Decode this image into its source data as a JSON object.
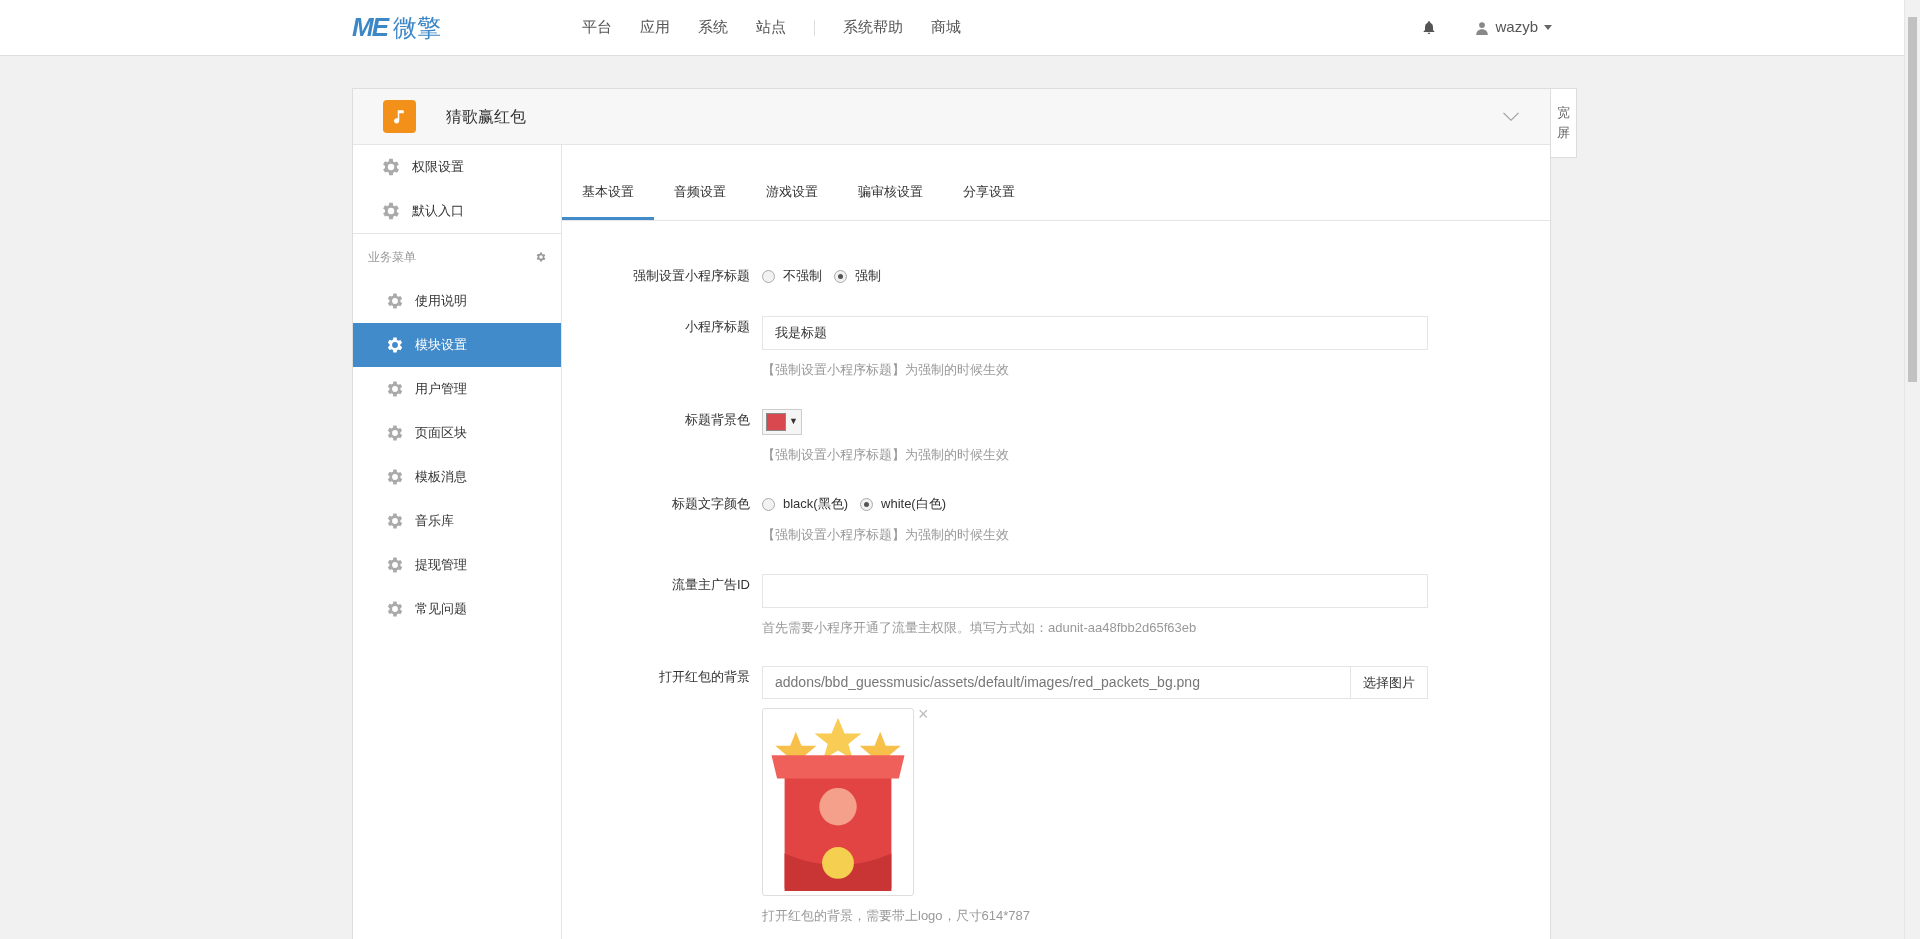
{
  "header": {
    "logo_mark": "ME",
    "logo_text": "微擎",
    "nav": [
      {
        "label": "平台",
        "kind": "link"
      },
      {
        "label": "应用",
        "kind": "link"
      },
      {
        "label": "系统",
        "kind": "link"
      },
      {
        "label": "站点",
        "kind": "link"
      },
      {
        "kind": "divider"
      },
      {
        "label": "系统帮助",
        "kind": "link"
      },
      {
        "label": "商城",
        "kind": "link"
      }
    ],
    "user": "wazyb"
  },
  "module": {
    "name": "猜歌赢红包",
    "widescreen_button": "宽屏"
  },
  "sidebar": {
    "top_items": [
      {
        "label": "权限设置",
        "selected": false
      },
      {
        "label": "默认入口",
        "selected": false
      }
    ],
    "section_title": "业务菜单",
    "items": [
      {
        "label": "使用说明",
        "selected": false
      },
      {
        "label": "模块设置",
        "selected": true
      },
      {
        "label": "用户管理",
        "selected": false
      },
      {
        "label": "页面区块",
        "selected": false
      },
      {
        "label": "模板消息",
        "selected": false
      },
      {
        "label": "音乐库",
        "selected": false
      },
      {
        "label": "提现管理",
        "selected": false
      },
      {
        "label": "常见问题",
        "selected": false
      }
    ]
  },
  "tabs": [
    {
      "label": "基本设置",
      "selected": true
    },
    {
      "label": "音频设置",
      "selected": false
    },
    {
      "label": "游戏设置",
      "selected": false
    },
    {
      "label": "骗审核设置",
      "selected": false
    },
    {
      "label": "分享设置",
      "selected": false
    }
  ],
  "form": [
    {
      "kind": "radio",
      "label": "强制设置小程序标题",
      "options": [
        {
          "label": "不强制",
          "selected": false
        },
        {
          "label": "强制",
          "selected": true
        }
      ]
    },
    {
      "kind": "text",
      "label": "小程序标题",
      "value": "我是标题",
      "help": "【强制设置小程序标题】为强制的时候生效"
    },
    {
      "kind": "color",
      "label": "标题背景色",
      "color": "#d9474f",
      "caret": "▼",
      "help": "【强制设置小程序标题】为强制的时候生效"
    },
    {
      "kind": "radio",
      "label": "标题文字颜色",
      "options": [
        {
          "label": "black(黑色)",
          "selected": false
        },
        {
          "label": "white(白色)",
          "selected": true
        }
      ],
      "help": "【强制设置小程序标题】为强制的时候生效"
    },
    {
      "kind": "text",
      "label": "流量主广告ID",
      "help": "首先需要小程序开通了流量主权限。填写方式如：adunit-aa48fbb2d65f63eb"
    },
    {
      "kind": "image",
      "label": "打开红包的背景",
      "value": "addons/bbd_guessmusic/assets/default/images/red_packets_bg.png",
      "button": "选择图片",
      "remove": "×",
      "help": "打开红包的背景，需要带上logo，尺寸614*787"
    }
  ]
}
